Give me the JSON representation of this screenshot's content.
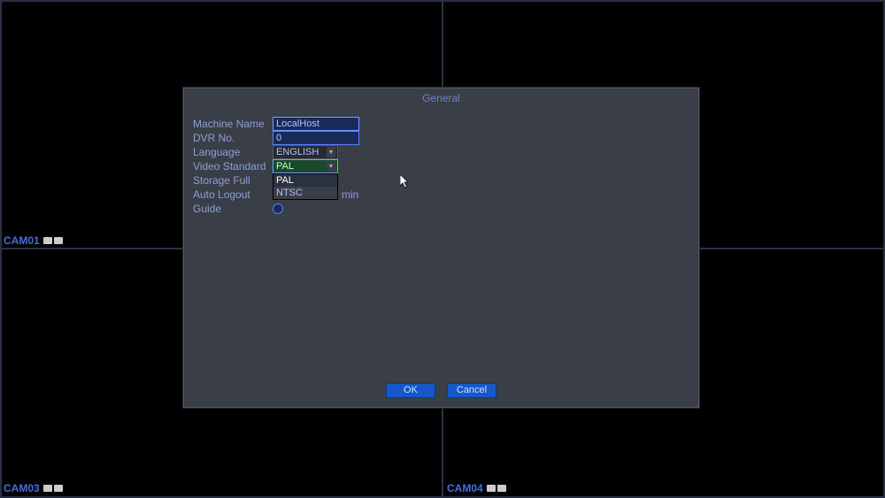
{
  "cameras": {
    "cam1": "CAM01",
    "cam3": "CAM03",
    "cam4": "CAM04"
  },
  "dialog": {
    "title": "General",
    "labels": {
      "machine_name": "Machine Name",
      "dvr_no": "DVR No.",
      "language": "Language",
      "video_standard": "Video Standard",
      "storage_full": "Storage Full",
      "auto_logout": "Auto Logout",
      "guide": "Guide"
    },
    "values": {
      "machine_name": "LocalHost",
      "dvr_no": "0",
      "language": "ENGLISH",
      "video_standard": "PAL",
      "auto_logout_unit": "min"
    },
    "video_standard_options": [
      "PAL",
      "NTSC"
    ],
    "buttons": {
      "ok": "OK",
      "cancel": "Cancel"
    }
  }
}
